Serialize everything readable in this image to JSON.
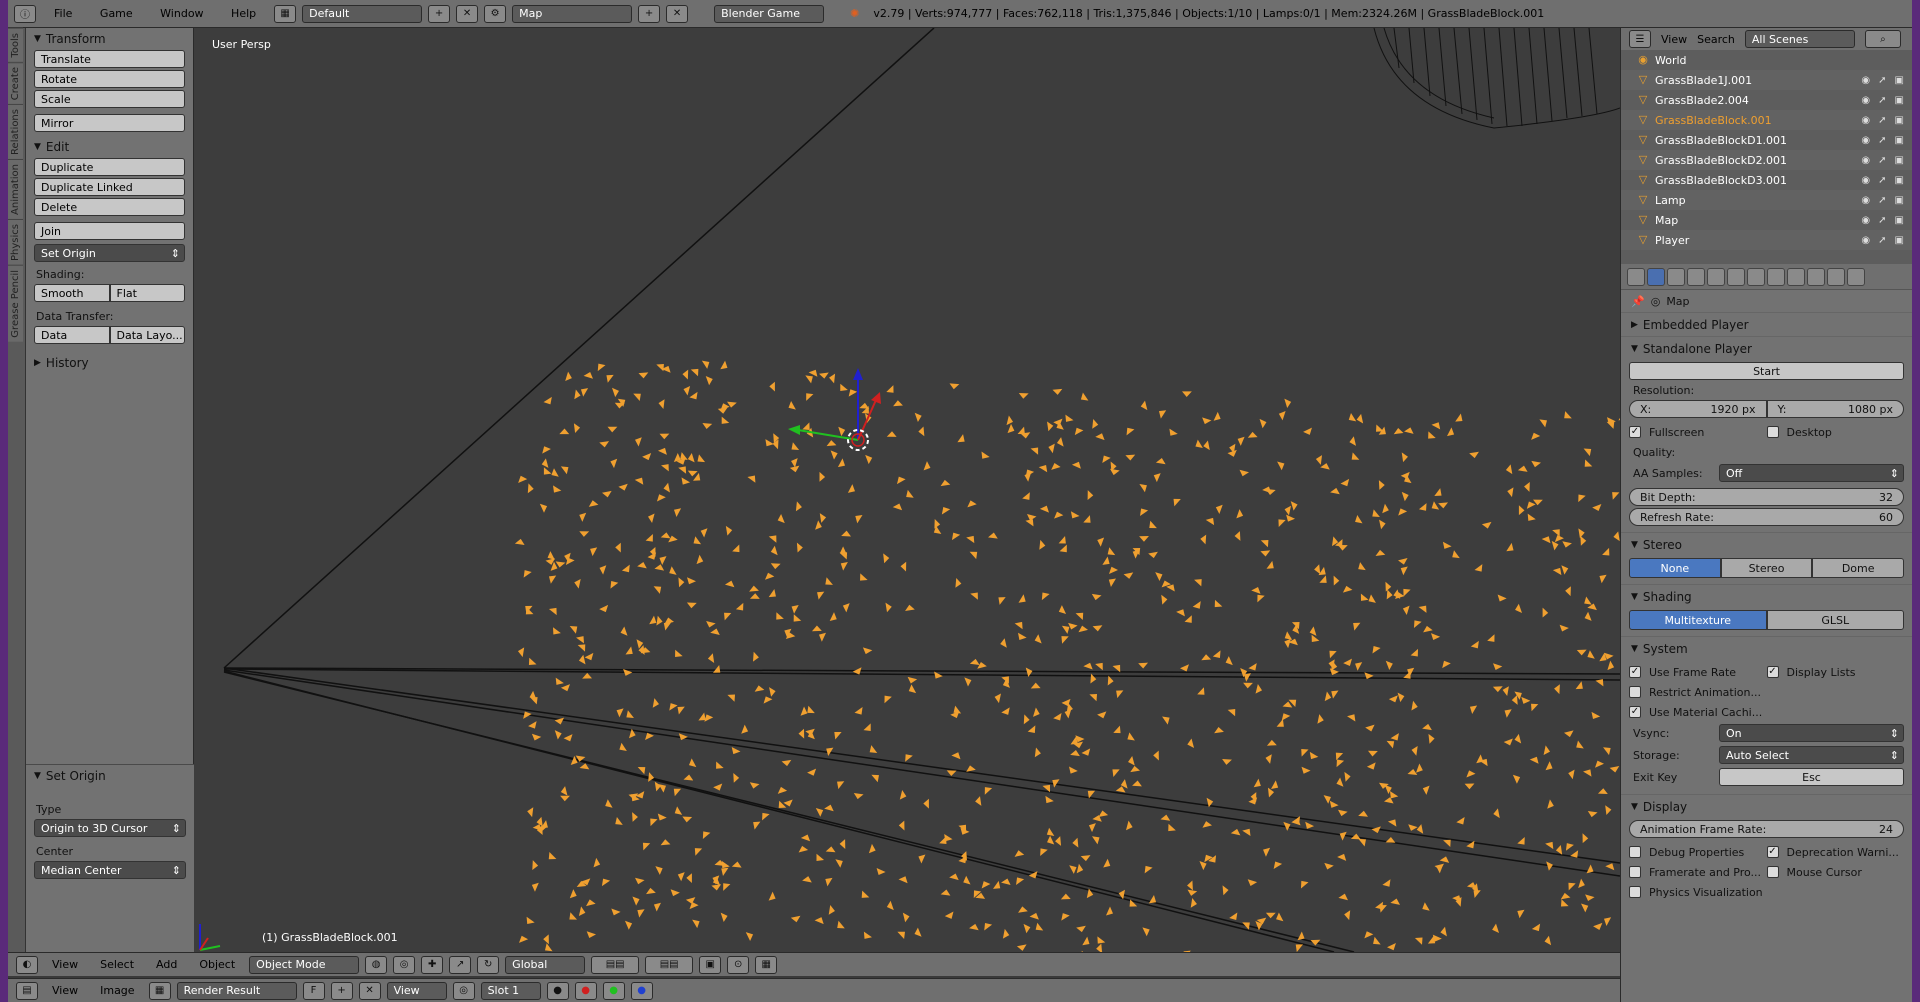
{
  "topbar": {
    "menu": [
      "File",
      "Game",
      "Window",
      "Help"
    ],
    "screen_layout": "Default",
    "scene": "Map",
    "engine": "Blender Game",
    "stats": "v2.79 | Verts:974,777 | Faces:762,118 | Tris:1,375,846 | Objects:1/10 | Lamps:0/1 | Mem:2324.26M | GrassBladeBlock.001"
  },
  "left_tabs": [
    "Tools",
    "Create",
    "Relations",
    "Animation",
    "Physics",
    "Grease Pencil"
  ],
  "toolshelf": {
    "transform": {
      "title": "Transform",
      "buttons": [
        "Translate",
        "Rotate",
        "Scale",
        "Mirror"
      ]
    },
    "edit": {
      "title": "Edit",
      "buttons": [
        "Duplicate",
        "Duplicate Linked",
        "Delete",
        "Join"
      ],
      "set_origin": "Set Origin",
      "shading_label": "Shading:",
      "shading_smooth": "Smooth",
      "shading_flat": "Flat",
      "data_transfer_label": "Data Transfer:",
      "data": "Data",
      "data_layout": "Data Layo..."
    },
    "history": "History"
  },
  "operator": {
    "title": "Set Origin",
    "type_label": "Type",
    "type_value": "Origin to 3D Cursor",
    "center_label": "Center",
    "center_value": "Median Center"
  },
  "viewport": {
    "label": "User Persp",
    "object_info": "(1) GrassBladeBlock.001",
    "grass_color": "#f0a030"
  },
  "view_header": {
    "menu": [
      "View",
      "Select",
      "Add",
      "Object"
    ],
    "mode": "Object Mode",
    "orientation": "Global"
  },
  "image_header": {
    "menu": [
      "View",
      "Image"
    ],
    "image_name": "Render Result",
    "f_label": "F",
    "view": "View",
    "slot": "Slot 1"
  },
  "outliner": {
    "view": "View",
    "search": "Search",
    "scenes": "All Scenes",
    "rows": [
      {
        "name": "World",
        "selected": false
      },
      {
        "name": "GrassBlade1J.001",
        "selected": false
      },
      {
        "name": "GrassBlade2.004",
        "selected": false
      },
      {
        "name": "GrassBladeBlock.001",
        "selected": true
      },
      {
        "name": "GrassBladeBlockD1.001",
        "selected": false
      },
      {
        "name": "GrassBladeBlockD2.001",
        "selected": false
      },
      {
        "name": "GrassBladeBlockD3.001",
        "selected": false
      },
      {
        "name": "Lamp",
        "selected": false
      },
      {
        "name": "Map",
        "selected": false
      },
      {
        "name": "Player",
        "selected": false
      }
    ]
  },
  "properties": {
    "context": "Map",
    "embedded_player": "Embedded Player",
    "standalone_player": "Standalone Player",
    "start": "Start",
    "resolution_label": "Resolution:",
    "res_x_label": "X:",
    "res_x": "1920 px",
    "res_y_label": "Y:",
    "res_y": "1080 px",
    "fullscreen": "Fullscreen",
    "desktop": "Desktop",
    "quality_label": "Quality:",
    "aa_label": "AA Samples:",
    "aa_value": "Off",
    "bit_depth_label": "Bit Depth:",
    "bit_depth": "32",
    "refresh_label": "Refresh Rate:",
    "refresh": "60",
    "stereo": "Stereo",
    "stereo_opts": [
      "None",
      "Stereo",
      "Dome"
    ],
    "shading": "Shading",
    "shading_opts": [
      "Multitexture",
      "GLSL"
    ],
    "system": "System",
    "use_frame_rate": "Use Frame Rate",
    "display_lists": "Display Lists",
    "restrict_anim": "Restrict Animation...",
    "use_material_cache": "Use Material Cachi...",
    "vsync_label": "Vsync:",
    "vsync": "On",
    "storage_label": "Storage:",
    "storage": "Auto Select",
    "exit_key_label": "Exit Key",
    "exit_key": "Esc",
    "display": "Display",
    "anim_frame_rate_label": "Animation Frame Rate:",
    "anim_frame_rate": "24",
    "debug_props": "Debug Properties",
    "deprecation": "Deprecation Warni...",
    "framerate_profile": "Framerate and Pro...",
    "mouse_cursor": "Mouse Cursor",
    "physics_vis": "Physics Visualization"
  }
}
